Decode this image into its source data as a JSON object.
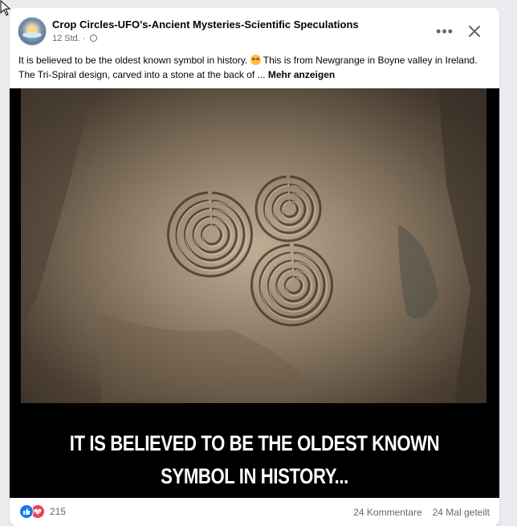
{
  "post": {
    "page_name": "Crop Circles-UFO's-Ancient Mysteries-Scientific Speculations",
    "time": "12 Std. ·",
    "caption_start": "It is believed to be the oldest known symbol in history.",
    "caption_end": "This is from Newgrange in Boyne valley in Ireland. The Tri-Spiral design, carved into a stone at the back of ...",
    "see_more": "Mehr anzeigen",
    "image_text_line1": "IT IS BELIEVED TO BE THE OLDEST KNOWN",
    "image_text_line2": "SYMBOL IN HISTORY..."
  },
  "icons": {
    "more": "more-options-icon",
    "close": "close-icon",
    "privacy": "globe-icon",
    "emoji": "star-struck-emoji",
    "like": "like-reaction-icon",
    "love": "love-reaction-icon"
  },
  "stats": {
    "reaction_count": "215",
    "comments": "24 Kommentare",
    "shares": "24 Mal geteilt"
  },
  "colors": {
    "like": "#1877f2",
    "love": "#f33e58",
    "secondary_text": "#65676b"
  }
}
